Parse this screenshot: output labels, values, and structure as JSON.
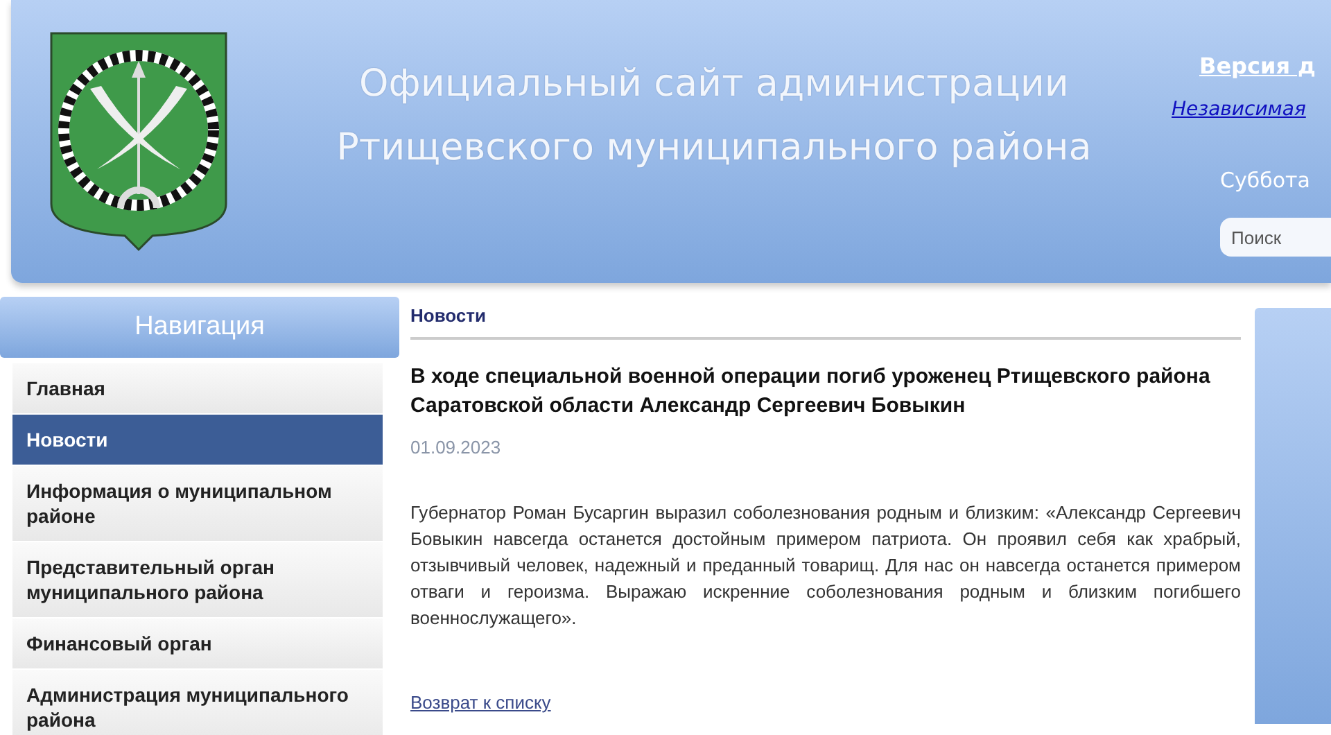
{
  "header": {
    "title_lines": [
      "Официальный сайт администрации",
      "Ртищевского муниципального района"
    ],
    "accessibility_link": "Версия д",
    "independent_link": "Независимая",
    "date": "Суббота",
    "search": {
      "placeholder": "Поиск"
    }
  },
  "navigation": {
    "title": "Навигация",
    "items": [
      {
        "label": "Главная",
        "selected": false
      },
      {
        "label": "Новости",
        "selected": true
      },
      {
        "label": "Информация о муниципальном районе",
        "selected": false
      },
      {
        "label": "Представительный орган муниципального района",
        "selected": false
      },
      {
        "label": "Финансовый орган",
        "selected": false
      },
      {
        "label": "Администрация муниципального района",
        "selected": false
      }
    ]
  },
  "article": {
    "breadcrumb": "Новости",
    "title": "В ходе специальной военной операции погиб уроженец Ртищевского района Саратовской области Александр Сергеевич Бовыкин",
    "date": "01.09.2023",
    "body": "Губернатор Роман Бусаргин выразил соболезнования родным и близким: «Александр Сергеевич Бовыкин навсегда останется достойным примером патриота. Он проявил себя как храбрый, отзывчивый человек, надежный и преданный товарищ. Для нас он навсегда останется примером отваги и героизма. Выражаю искренние соболезнования родным и близким погибшего военнослужащего».",
    "back_link": "Возврат к списку"
  }
}
